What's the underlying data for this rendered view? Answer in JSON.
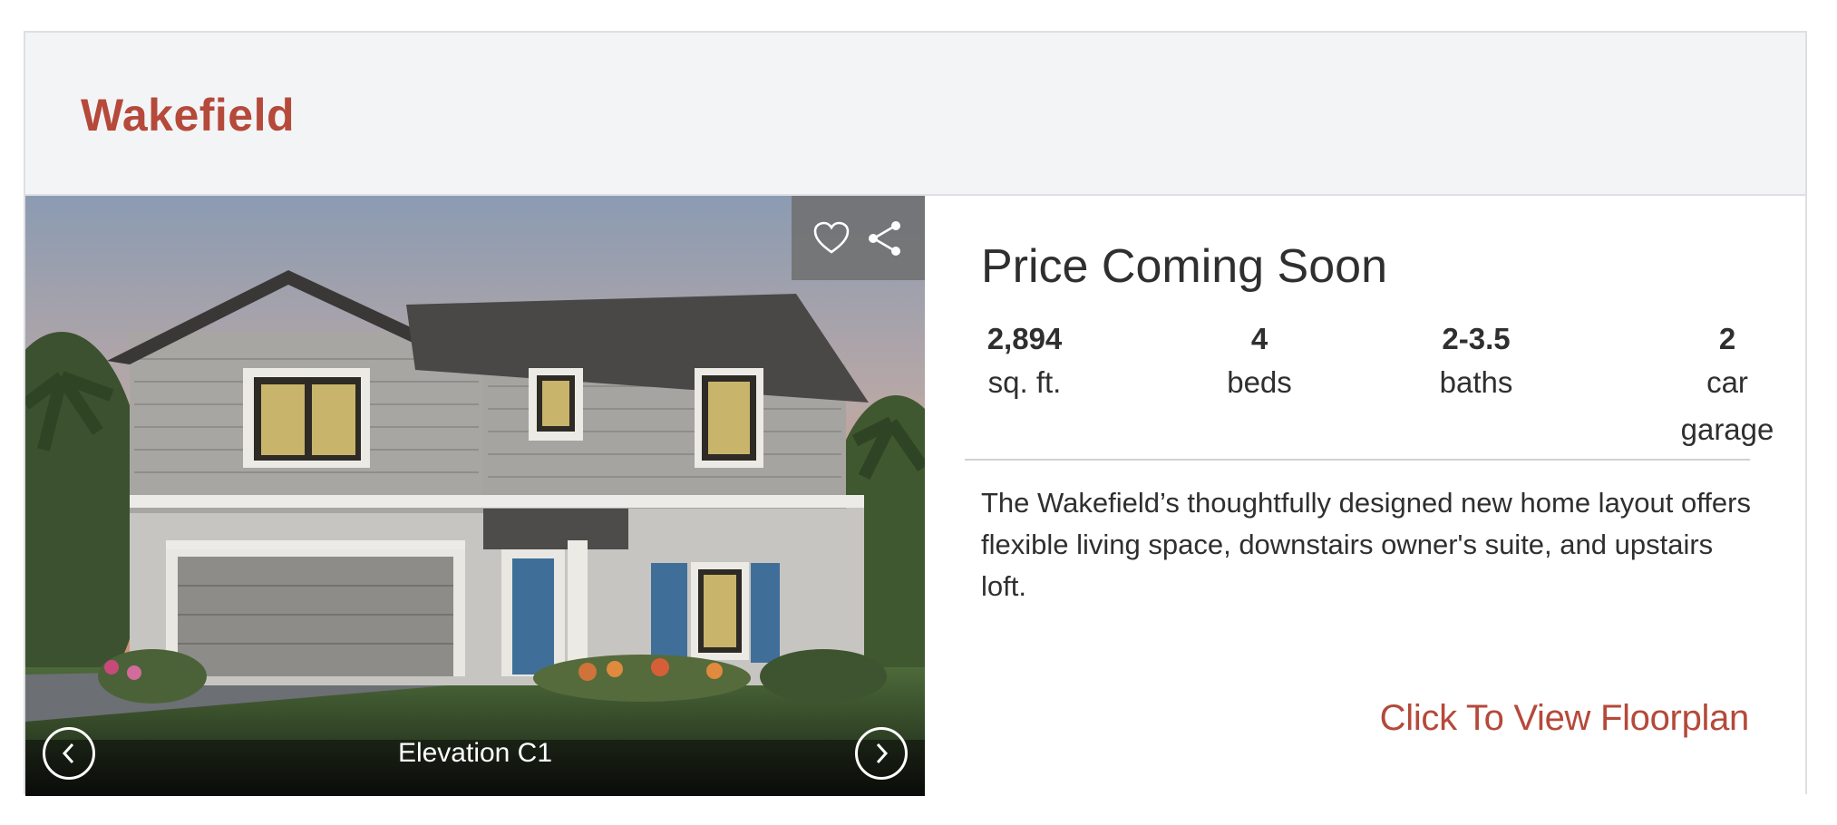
{
  "header": {
    "title": "Wakefield"
  },
  "gallery": {
    "caption": "Elevation C1",
    "actions": {
      "favorite_icon": "heart-outline-icon",
      "share_icon": "share-icon"
    },
    "nav": {
      "prev_icon": "chevron-left-icon",
      "next_icon": "chevron-right-icon"
    }
  },
  "details": {
    "price": "Price Coming Soon",
    "stats": [
      {
        "value": "2,894",
        "label": "sq. ft."
      },
      {
        "value": "4",
        "label": "beds"
      },
      {
        "value": "2-3.5",
        "label": "baths"
      },
      {
        "value": "2",
        "label": "car garage"
      }
    ],
    "description": "The Wakefield’s thoughtfully designed new home layout offers flexible living space, downstairs owner's suite, and upstairs loft.",
    "floorplan_link": "Click To View Floorplan"
  },
  "colors": {
    "accent": "#b5493a",
    "header_bg": "#f3f4f6",
    "border": "#dddfe2"
  }
}
